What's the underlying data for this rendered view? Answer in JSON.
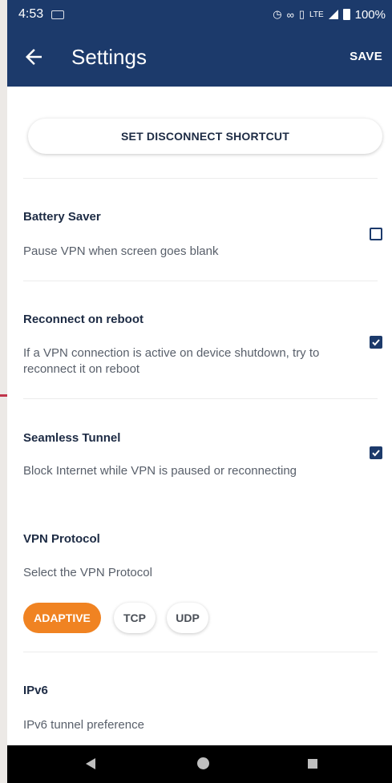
{
  "status_bar": {
    "time": "4:53",
    "network": "LTE",
    "battery": "100%"
  },
  "toolbar": {
    "title": "Settings",
    "save_label": "SAVE"
  },
  "shortcut_button": "SET DISCONNECT SHORTCUT",
  "sections": [
    {
      "title": "Battery Saver",
      "description": "Pause VPN when screen goes blank",
      "checked": false
    },
    {
      "title": "Reconnect on reboot",
      "description": "If a VPN connection is active on device shutdown, try to reconnect it on reboot",
      "checked": true
    },
    {
      "title": "Seamless Tunnel",
      "description": "Block Internet while VPN is paused or reconnecting",
      "checked": true
    }
  ],
  "protocol": {
    "title": "VPN Protocol",
    "description": "Select the VPN Protocol",
    "options": [
      "ADAPTIVE",
      "TCP",
      "UDP"
    ],
    "selected": "ADAPTIVE"
  },
  "ipv6": {
    "title": "IPv6",
    "description": "IPv6 tunnel preference"
  },
  "colors": {
    "primary": "#1c3a6b",
    "accent": "#f08322"
  }
}
